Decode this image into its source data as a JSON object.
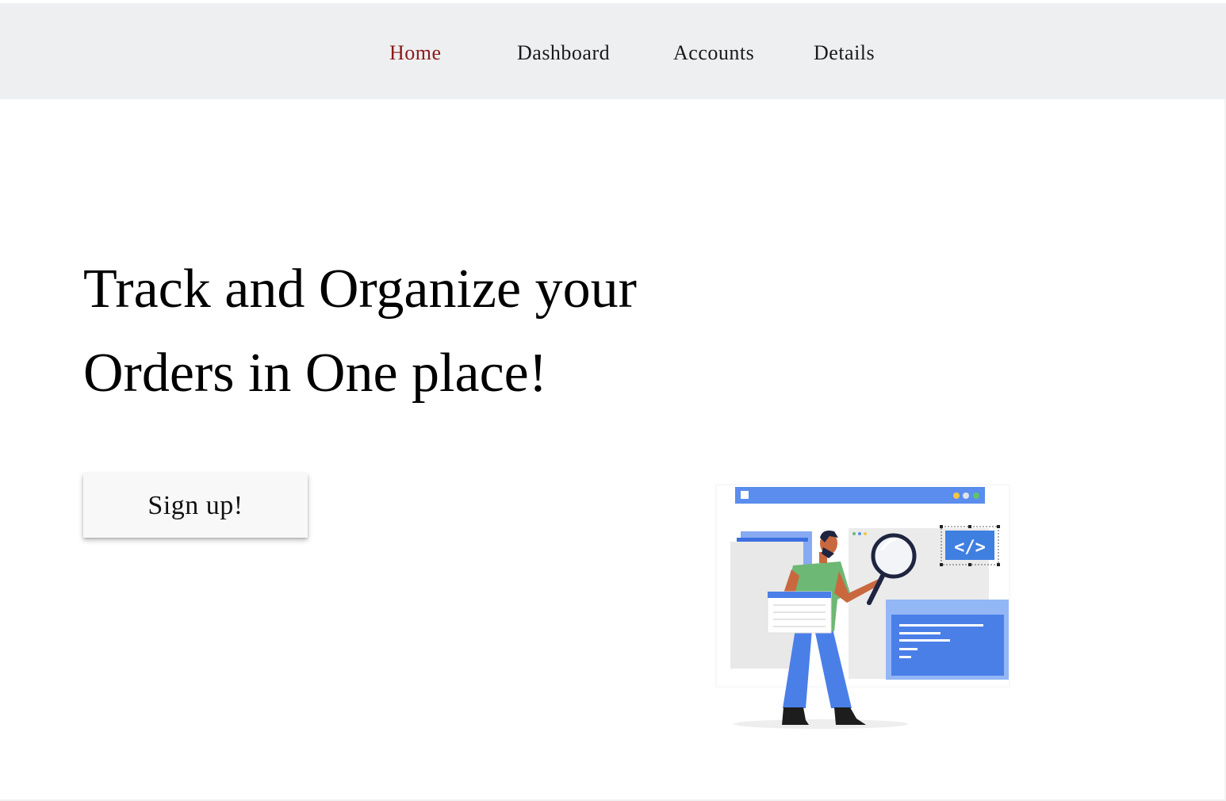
{
  "nav": {
    "items": [
      {
        "label": "Home",
        "active": true
      },
      {
        "label": "Dashboard",
        "active": false
      },
      {
        "label": "Accounts",
        "active": false
      },
      {
        "label": "Details",
        "active": false
      }
    ]
  },
  "hero": {
    "title_line1": "Track and Organize your",
    "title_line2": "Orders in One place!",
    "signup_label": "Sign up!"
  },
  "illustration": {
    "code_label": "</>"
  },
  "colors": {
    "nav_background": "#eeeff0",
    "active_link": "#8b1a1a",
    "accent_blue": "#4a7fe8",
    "shirt_green": "#6db874"
  }
}
